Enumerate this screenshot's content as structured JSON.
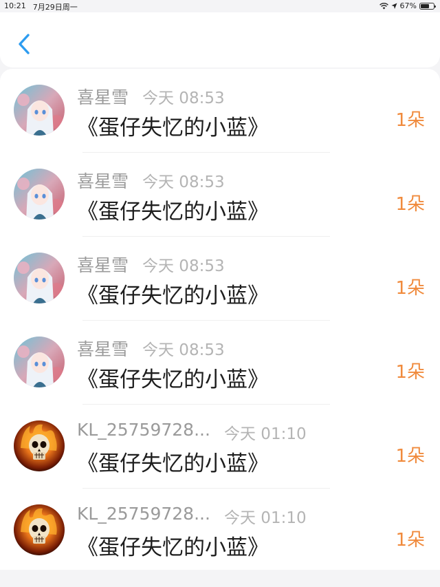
{
  "status_bar": {
    "time": "10:21",
    "date": "7月29日周一",
    "battery_percent": "67%",
    "battery_level": 0.67,
    "icons": [
      "wifi-icon",
      "location-icon",
      "battery-icon"
    ]
  },
  "nav": {
    "back_icon": "chevron-left-icon",
    "accent_color": "#2d9cf0"
  },
  "records": [
    {
      "sender": "喜星雪",
      "time": "今天 08:53",
      "gift": "《蛋仔失忆的小蓝》",
      "count": "1朵",
      "avatar": "anime-girl-avatar"
    },
    {
      "sender": "喜星雪",
      "time": "今天 08:53",
      "gift": "《蛋仔失忆的小蓝》",
      "count": "1朵",
      "avatar": "anime-girl-avatar"
    },
    {
      "sender": "喜星雪",
      "time": "今天 08:53",
      "gift": "《蛋仔失忆的小蓝》",
      "count": "1朵",
      "avatar": "anime-girl-avatar"
    },
    {
      "sender": "喜星雪",
      "time": "今天 08:53",
      "gift": "《蛋仔失忆的小蓝》",
      "count": "1朵",
      "avatar": "anime-girl-avatar"
    },
    {
      "sender": "KL_25759728...",
      "time": "今天 01:10",
      "gift": "《蛋仔失忆的小蓝》",
      "count": "1朵",
      "avatar": "flaming-skull-avatar"
    },
    {
      "sender": "KL_25759728...",
      "time": "今天 01:10",
      "gift": "《蛋仔失忆的小蓝》",
      "count": "1朵",
      "avatar": "flaming-skull-avatar"
    }
  ],
  "colors": {
    "count_color": "#f08a3c",
    "name_color": "#9a9a9a",
    "time_color": "#b4b4b4"
  }
}
